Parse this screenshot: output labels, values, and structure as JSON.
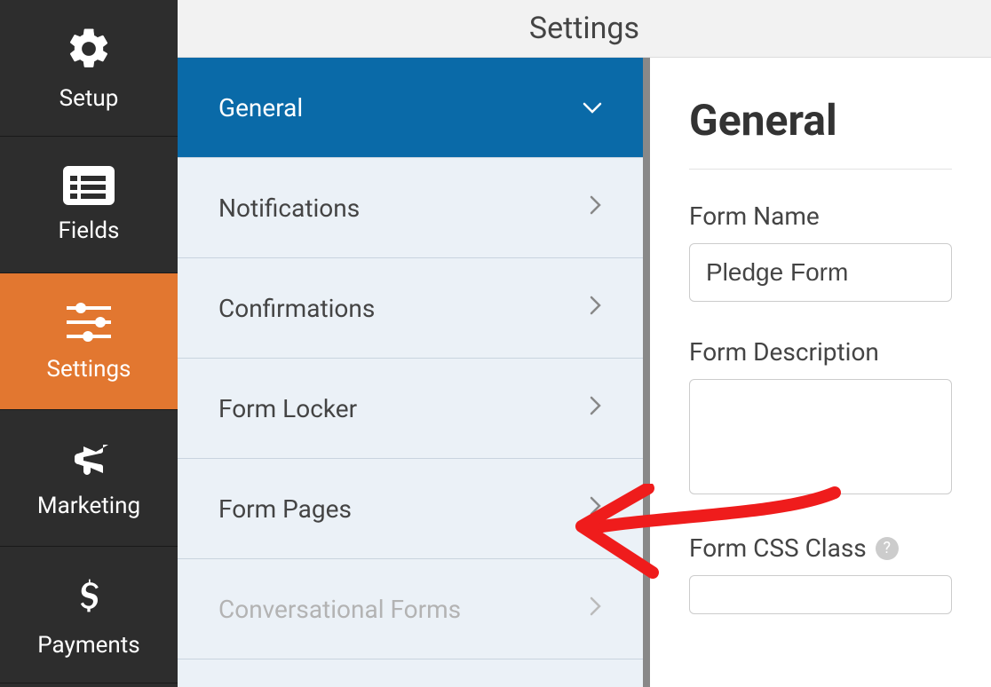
{
  "sidebar": {
    "items": [
      {
        "label": "Setup"
      },
      {
        "label": "Fields"
      },
      {
        "label": "Settings"
      },
      {
        "label": "Marketing"
      },
      {
        "label": "Payments"
      }
    ]
  },
  "topbar": {
    "title": "Settings"
  },
  "settingsNav": {
    "items": [
      {
        "label": "General"
      },
      {
        "label": "Notifications"
      },
      {
        "label": "Confirmations"
      },
      {
        "label": "Form Locker"
      },
      {
        "label": "Form Pages"
      },
      {
        "label": "Conversational Forms"
      }
    ]
  },
  "panel": {
    "title": "General",
    "formNameLabel": "Form Name",
    "formNameValue": "Pledge Form",
    "formDescLabel": "Form Description",
    "formDescValue": "",
    "formCssLabel": "Form CSS Class"
  }
}
